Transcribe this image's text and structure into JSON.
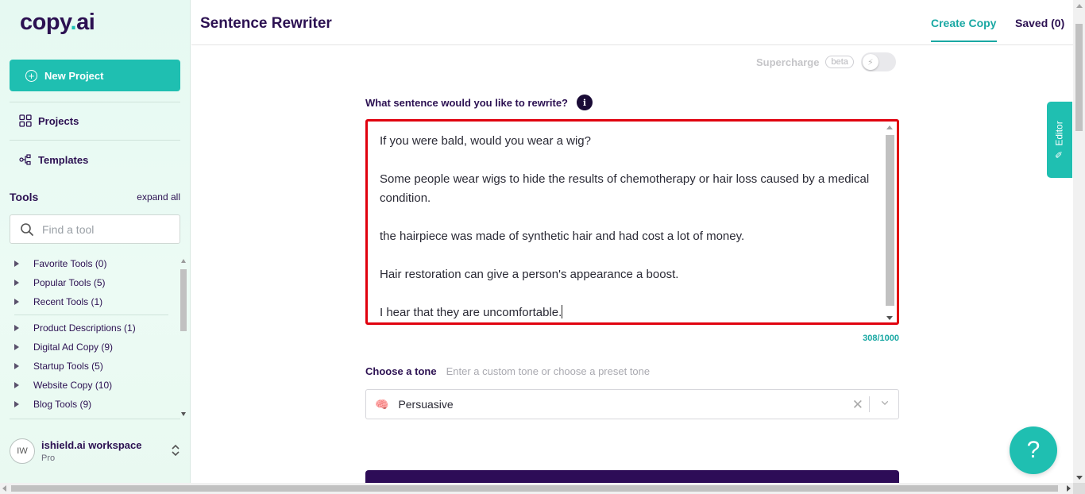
{
  "sidebar": {
    "logo": {
      "text_a": "copy",
      "text_dot": ".",
      "text_b": "ai"
    },
    "new_project_label": "New Project",
    "nav": [
      {
        "label": "Projects",
        "icon": "grid-icon"
      },
      {
        "label": "Templates",
        "icon": "templates-icon"
      }
    ],
    "tools_title": "Tools",
    "expand_all": "expand all",
    "search_placeholder": "Find a tool",
    "tool_groups": [
      {
        "label": "Favorite Tools (0)"
      },
      {
        "label": "Popular Tools (5)"
      },
      {
        "label": "Recent Tools (1)"
      },
      {
        "label": "Product Descriptions (1)"
      },
      {
        "label": "Digital Ad Copy (9)"
      },
      {
        "label": "Startup Tools (5)"
      },
      {
        "label": "Website Copy (10)"
      },
      {
        "label": "Blog Tools (9)"
      }
    ],
    "workspace": {
      "initials": "IW",
      "name": "ishield.ai workspace",
      "plan": "Pro"
    }
  },
  "header": {
    "title": "Sentence Rewriter",
    "tabs": [
      {
        "label": "Create Copy",
        "active": true
      },
      {
        "label": "Saved (0)",
        "active": false
      }
    ]
  },
  "main": {
    "supercharge": {
      "label": "Supercharge",
      "badge": "beta",
      "enabled": false
    },
    "question": "What sentence would you like to rewrite?",
    "info_glyph": "i",
    "input_paragraphs": [
      "If you were bald, would you wear a wig?",
      "Some people wear wigs to hide the results of chemotherapy or hair loss caused by a medical condition.",
      "the hairpiece was made of synthetic hair and had cost a lot of money.",
      "Hair restoration can give a person's appearance a boost.",
      "I hear that they are uncomfortable."
    ],
    "char_count": "308/1000",
    "tone": {
      "label": "Choose a tone",
      "hint": "Enter a custom tone or choose a preset tone",
      "emoji": "🧠",
      "selected": "Persuasive"
    }
  },
  "editor_tab": {
    "label": "Editor"
  },
  "help_button": {
    "glyph": "?"
  },
  "colors": {
    "accent_teal": "#1fbfb1",
    "brand_purple": "#2c1152",
    "highlight_red": "#e0000e",
    "generate_button": "#2d0c57"
  }
}
